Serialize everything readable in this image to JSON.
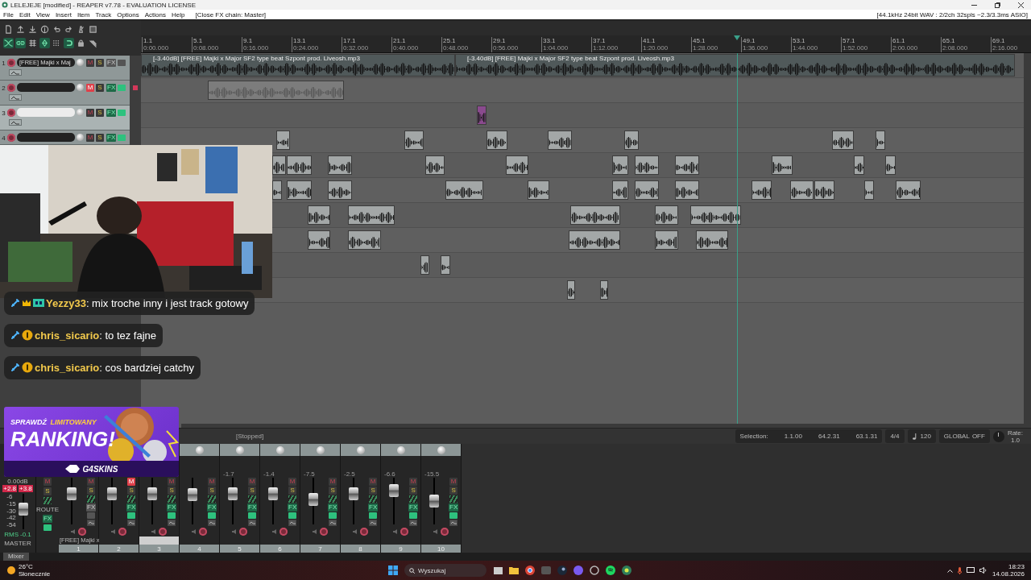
{
  "window": {
    "title": "LELEJEJE [modified] - REAPER v7.78 - EVALUATION LICENSE"
  },
  "menu": {
    "items": [
      "File",
      "Edit",
      "View",
      "Insert",
      "Item",
      "Track",
      "Options",
      "Actions",
      "Help"
    ],
    "status": "[Close FX chain: Master]",
    "audio_info": "[44.1kHz 24bit WAV : 2/2ch 32spls ~2.3/3.3ms ASIO]"
  },
  "toolbar": [
    {
      "on": false
    },
    {
      "on": false
    },
    {
      "on": false
    },
    {
      "on": false
    },
    {
      "on": false
    },
    {
      "on": false
    },
    {
      "on": false
    },
    {
      "on": false
    },
    {
      "on": true
    },
    {
      "on": true
    },
    {
      "on": false
    },
    {
      "on": true
    },
    {
      "on": false
    },
    {
      "on": true
    },
    {
      "on": false
    },
    {
      "on": false
    }
  ],
  "ruler": [
    {
      "bar": "1.1",
      "time": "0:00.000"
    },
    {
      "bar": "5.1",
      "time": "0:08.000"
    },
    {
      "bar": "9.1",
      "time": "0:16.000"
    },
    {
      "bar": "13.1",
      "time": "0:24.000"
    },
    {
      "bar": "17.1",
      "time": "0:32.000"
    },
    {
      "bar": "21.1",
      "time": "0:40.000"
    },
    {
      "bar": "25.1",
      "time": "0:48.000"
    },
    {
      "bar": "29.1",
      "time": "0:56.000"
    },
    {
      "bar": "33.1",
      "time": "1:04.000"
    },
    {
      "bar": "37.1",
      "time": "1:12.000"
    },
    {
      "bar": "41.1",
      "time": "1:20.000"
    },
    {
      "bar": "45.1",
      "time": "1:28.000"
    },
    {
      "bar": "49.1",
      "time": "1:36.000"
    },
    {
      "bar": "53.1",
      "time": "1:44.000"
    },
    {
      "bar": "57.1",
      "time": "1:52.000"
    },
    {
      "bar": "61.1",
      "time": "2:00.000"
    },
    {
      "bar": "65.1",
      "time": "2:08.000"
    },
    {
      "bar": "69.1",
      "time": "2:16.000"
    }
  ],
  "tracks": [
    {
      "number": "1",
      "name": "[FREE] Majki x Maj",
      "selected": false,
      "mute_label": "M",
      "muted": false,
      "solo_label": "S",
      "fx_label": "FX",
      "fx_on": false
    },
    {
      "number": "2",
      "selected": false,
      "mute_label": "M",
      "muted": true,
      "solo_label": "S",
      "fx_label": "FX",
      "fx_on": true
    },
    {
      "number": "3",
      "selected": true,
      "mute_label": "M",
      "muted": false,
      "solo_label": "S",
      "fx_label": "FX",
      "fx_on": true
    },
    {
      "number": "4",
      "selected": false,
      "mute_label": "M",
      "muted": false,
      "solo_label": "S",
      "fx_label": "FX",
      "fx_on": true
    }
  ],
  "items": [
    {
      "label": "[-3.40dB] [FREE] Majki x Major SF2 type beat Szpont prod. Liveosh.mp3"
    },
    {
      "label": "[-3.40dB] [FREE] Majki x Major SF2 type beat Szpont prod. Liveosh.mp3"
    }
  ],
  "transport": {
    "status": "[Stopped]",
    "selection_label": "Selection:",
    "selection": [
      "1.1.00",
      "64.2.31",
      "63.1.31"
    ],
    "time_signature": "4/4",
    "tempo": "120",
    "automation": "GLOBAL",
    "automation_mode": "OFF",
    "rate_label": "Rate:",
    "rate": "1.0"
  },
  "mixer": {
    "master": {
      "peak": "0.00dB",
      "meter_left": "+2.8",
      "meter_right": "+3.8",
      "scale": [
        "-6",
        "-15",
        "-30",
        "-42",
        "-54"
      ],
      "rms_label": "RMS",
      "rms": "-0.1",
      "name": "MASTER",
      "mute_label": "M",
      "solo_label": "S",
      "route": "ROUTE",
      "fx_label": "FX",
      "level": 0.62
    },
    "strips": [
      {
        "number": "1",
        "name": "[FREE] Majki x",
        "level": 0.72,
        "selected": false,
        "mute_label": "M",
        "muted": false,
        "solo_label": "S",
        "fx_label": "FX",
        "fx_on": false
      },
      {
        "number": "2",
        "level": 0.72,
        "selected": false,
        "mute_label": "M",
        "muted": true,
        "solo_label": "S",
        "fx_label": "FX",
        "fx_on": true
      },
      {
        "number": "3",
        "level": 0.72,
        "selected": true,
        "mute_label": "M",
        "muted": false,
        "solo_label": "S",
        "fx_label": "FX",
        "fx_on": true
      },
      {
        "number": "4",
        "level": 0.68,
        "selected": false,
        "mute_label": "M",
        "muted": false,
        "solo_label": "S",
        "fx_label": "FX",
        "fx_on": true
      },
      {
        "number": "5",
        "reading": "-1.7",
        "level": 0.72,
        "selected": false,
        "mute_label": "M",
        "muted": false,
        "solo_label": "S",
        "fx_label": "FX",
        "fx_on": true
      },
      {
        "number": "6",
        "reading": "-1.4",
        "level": 0.72,
        "selected": false,
        "mute_label": "M",
        "muted": false,
        "solo_label": "S",
        "fx_label": "FX",
        "fx_on": true
      },
      {
        "number": "7",
        "reading": "-7.5",
        "level": 0.55,
        "selected": false,
        "mute_label": "M",
        "muted": false,
        "solo_label": "S",
        "fx_label": "FX",
        "fx_on": true
      },
      {
        "number": "8",
        "reading": "-2.5",
        "level": 0.72,
        "selected": false,
        "mute_label": "M",
        "muted": false,
        "solo_label": "S",
        "fx_label": "FX",
        "fx_on": true
      },
      {
        "number": "9",
        "reading": "-6.6",
        "level": 0.8,
        "selected": false,
        "mute_label": "M",
        "muted": false,
        "solo_label": "S",
        "fx_label": "FX",
        "fx_on": true
      },
      {
        "number": "10",
        "reading": "-15.5",
        "level": 0.5,
        "selected": false,
        "mute_label": "M",
        "muted": false,
        "solo_label": "S",
        "fx_label": "FX",
        "fx_on": true
      }
    ],
    "tab": "Mixer"
  },
  "chat": [
    {
      "kind": "vip",
      "text": "**Yezzy33**: mix troche inny i jest track gotowy",
      "color": "#f2c94c"
    },
    {
      "kind": "subscriber",
      "text": "**chris_sicario**: to tez fajne",
      "color": "#f2c94c"
    },
    {
      "kind": "subscriber",
      "text": "**chris_sicario**: cos bardziej catchy",
      "color": "#f2c94c"
    }
  ],
  "ad": {
    "kicker": "SPRAWDŹ",
    "kicker_highlight": "LIMITOWANY",
    "headline": "RANKING!",
    "brand": "G4SKINS"
  },
  "taskbar": {
    "temperature": "26°C",
    "weather": "Słonecznie",
    "search": {
      "placeholder": "Wyszukaj"
    },
    "time": "18:23",
    "date": "14.08.2026"
  }
}
